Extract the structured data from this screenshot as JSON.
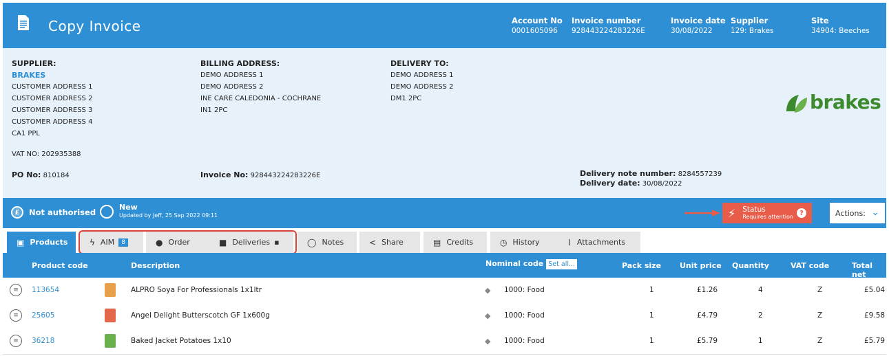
{
  "header": {
    "title": "Copy Invoice",
    "fields": [
      {
        "label": "Account No",
        "value": "0001605096"
      },
      {
        "label": "Invoice number",
        "value": "928443224283226E"
      },
      {
        "label": "Invoice date",
        "value": "30/08/2022"
      },
      {
        "label": "Supplier",
        "value": "129: Brakes"
      },
      {
        "label": "Site",
        "value": "34904: Beeches"
      }
    ]
  },
  "supplier": {
    "heading": "SUPPLIER:",
    "name": "BRAKES",
    "lines": [
      "CUSTOMER ADDRESS 1",
      "CUSTOMER ADDRESS 2",
      "CUSTOMER ADDRESS 3",
      "CUSTOMER ADDRESS 4",
      "CA1 PPL"
    ],
    "vat": "VAT NO: 202935388"
  },
  "billing": {
    "heading": "BILLING ADDRESS:",
    "lines": [
      "DEMO ADDRESS 1",
      "DEMO ADDRESS 2",
      "INE CARE CALEDONIA - COCHRANE",
      "IN1 2PC"
    ]
  },
  "delivery": {
    "heading": "DELIVERY TO:",
    "lines": [
      "DEMO ADDRESS 1",
      "DEMO ADDRESS 2",
      "DM1 2PC"
    ]
  },
  "refs": {
    "po_label": "PO No:",
    "po_value": "810184",
    "invoice_label": "Invoice No:",
    "invoice_value": "928443224283226E",
    "dn_label": "Delivery note number:",
    "dn_value": "8284557239",
    "dd_label": "Delivery date:",
    "dd_value": "30/08/2022"
  },
  "logo": {
    "text": "brakes",
    "color": "#3d8a2e"
  },
  "status": {
    "auth": "Not authorised",
    "state": "New",
    "updated": "Updated by Jeff, 25 Sep 2022 09:11",
    "status_label": "Status",
    "status_sub": "Requires attention",
    "actions": "Actions:"
  },
  "tabs": [
    {
      "label": "Products",
      "icon": "box-icon"
    },
    {
      "label": "AIM",
      "icon": "bolt-icon",
      "badge": "8"
    },
    {
      "label": "Order",
      "icon": "apple-icon"
    },
    {
      "label": "Deliveries",
      "icon": "truck-icon"
    },
    {
      "label": "Notes",
      "icon": "comment-icon"
    },
    {
      "label": "Share",
      "icon": "share-icon"
    },
    {
      "label": "Credits",
      "icon": "document-icon"
    },
    {
      "label": "History",
      "icon": "clock-icon"
    },
    {
      "label": "Attachments",
      "icon": "paperclip-icon"
    }
  ],
  "table": {
    "columns": {
      "code": "Product code",
      "desc": "Description",
      "nominal": "Nominal code",
      "set_all": "Set all...",
      "pack": "Pack size",
      "unit": "Unit price",
      "qty": "Quantity",
      "vat": "VAT code",
      "total": "Total net"
    },
    "rows": [
      {
        "code": "113654",
        "desc": "ALPRO Soya For Professionals 1x1ltr",
        "nominal": "1000: Food",
        "pack": "1",
        "unit": "£1.26",
        "qty": "4",
        "vat": "Z",
        "total": "£5.04",
        "thumb_color": "#e9a04a"
      },
      {
        "code": "25605",
        "desc": "Angel Delight Butterscotch GF 1x600g",
        "nominal": "1000: Food",
        "pack": "1",
        "unit": "£4.79",
        "qty": "2",
        "vat": "Z",
        "total": "£9.58",
        "thumb_color": "#e5674a"
      },
      {
        "code": "36218",
        "desc": "Baked Jacket Potatoes 1x10",
        "nominal": "1000: Food",
        "pack": "1",
        "unit": "£5.79",
        "qty": "1",
        "vat": "Z",
        "total": "£5.79",
        "thumb_color": "#6ab04c"
      }
    ]
  },
  "colors": {
    "primary": "#2e8fd4",
    "alert": "#e85c4a",
    "panel": "#e6f1fa"
  }
}
